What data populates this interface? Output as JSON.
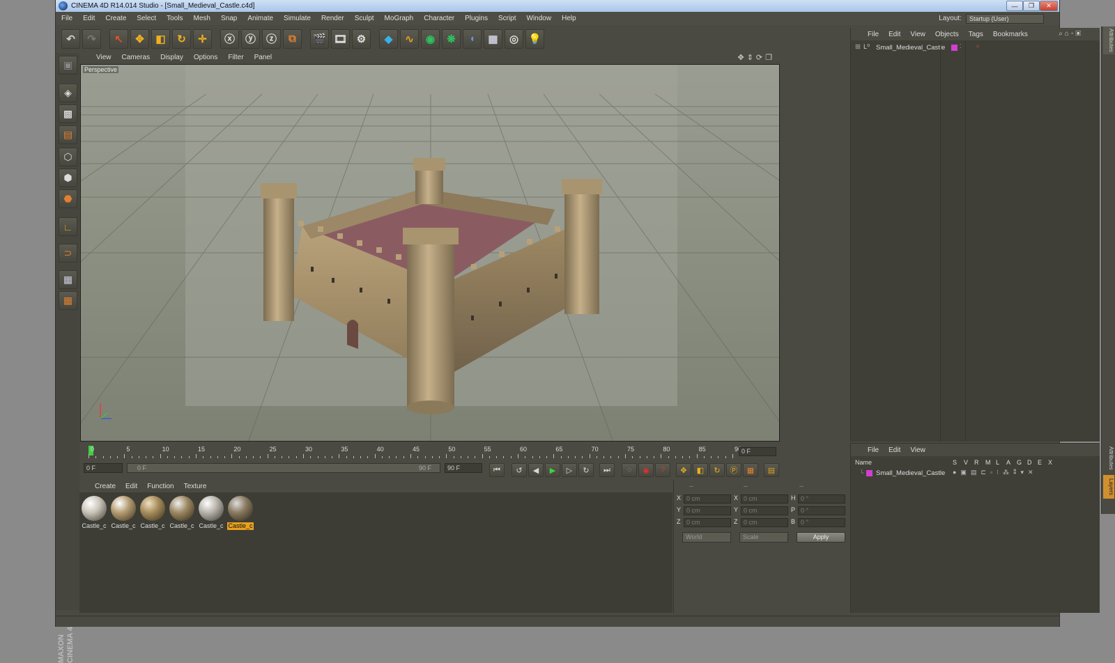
{
  "window": {
    "title": "CINEMA 4D R14.014 Studio - [Small_Medieval_Castle.c4d]"
  },
  "menu": [
    "File",
    "Edit",
    "Create",
    "Select",
    "Tools",
    "Mesh",
    "Snap",
    "Animate",
    "Simulate",
    "Render",
    "Sculpt",
    "MoGraph",
    "Character",
    "Plugins",
    "Script",
    "Window",
    "Help"
  ],
  "layout": {
    "label": "Layout:",
    "value": "Startup (User)"
  },
  "viewport": {
    "menu": [
      "View",
      "Cameras",
      "Display",
      "Options",
      "Filter",
      "Panel"
    ],
    "label": "Perspective"
  },
  "timeline": {
    "ticks": [
      "0",
      "5",
      "10",
      "15",
      "20",
      "25",
      "30",
      "35",
      "40",
      "45",
      "50",
      "55",
      "60",
      "65",
      "70",
      "75",
      "80",
      "85",
      "90"
    ],
    "current_frame": "0 F"
  },
  "transport": {
    "start": "0 F",
    "slider_start": "0 F",
    "slider_end": "90 F",
    "end": "90 F"
  },
  "materials": {
    "menu": [
      "Create",
      "Edit",
      "Function",
      "Texture"
    ],
    "items": [
      {
        "name": "Castle_c",
        "color": "#c9c4b8"
      },
      {
        "name": "Castle_c",
        "color": "#b49c72"
      },
      {
        "name": "Castle_c",
        "color": "#a68d5c"
      },
      {
        "name": "Castle_c",
        "color": "#9c8862"
      },
      {
        "name": "Castle_c",
        "color": "#b8b4ac"
      },
      {
        "name": "Castle_c",
        "color": "#8a7a60"
      }
    ],
    "selected_index": 5
  },
  "coords": {
    "headers": [
      "--",
      "--",
      "--"
    ],
    "rows": [
      {
        "a1": "X",
        "v1": "0 cm",
        "a2": "X",
        "v2": "0 cm",
        "a3": "H",
        "v3": "0 °"
      },
      {
        "a1": "Y",
        "v1": "0 cm",
        "a2": "Y",
        "v2": "0 cm",
        "a3": "P",
        "v3": "0 °"
      },
      {
        "a1": "Z",
        "v1": "0 cm",
        "a2": "Z",
        "v2": "0 cm",
        "a3": "B",
        "v3": "0 °"
      }
    ],
    "mode1": "World",
    "mode2": "Scale",
    "apply": "Apply"
  },
  "objects": {
    "menu": [
      "File",
      "Edit",
      "View",
      "Objects",
      "Tags",
      "Bookmarks"
    ],
    "items": [
      {
        "name": "Small_Medieval_Castle",
        "color": "#d040d0"
      }
    ]
  },
  "layers": {
    "menu": [
      "File",
      "Edit",
      "View"
    ],
    "columns": {
      "name": "Name",
      "flags": [
        "S",
        "V",
        "R",
        "M",
        "L",
        "A",
        "G",
        "D",
        "E",
        "X"
      ]
    },
    "items": [
      {
        "name": "Small_Medieval_Castle",
        "color": "#d040d0"
      }
    ]
  },
  "side_tabs": [
    "Attributes",
    "Layers"
  ],
  "brand": "MAXON CINEMA 4D"
}
